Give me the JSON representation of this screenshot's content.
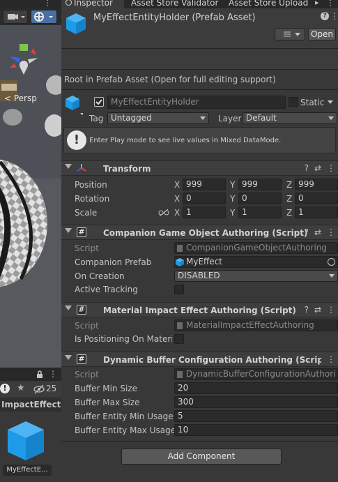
{
  "scene": {
    "persp_label": "< Persp"
  },
  "project": {
    "folder_name": "ImpactEffects",
    "visibility_count": "25",
    "asset_name": "MyEffectE..."
  },
  "tabs": [
    "Inspector",
    "Asset Store Validator",
    "Asset Store Upload"
  ],
  "header": {
    "title": "MyEffectEntityHolder (Prefab Asset)",
    "open_label": "Open"
  },
  "root_note": "Root in Prefab Asset (Open for full editing support)",
  "gameobject": {
    "name": "MyEffectEntityHolder",
    "static_label": "Static",
    "tag_label": "Tag",
    "tag_value": "Untagged",
    "layer_label": "Layer",
    "layer_value": "Default"
  },
  "info": {
    "icon": "!",
    "message": "Enter Play mode to see live values in Mixed DataMode."
  },
  "transform": {
    "title": "Transform",
    "rows": [
      {
        "label": "Position",
        "x": "999",
        "y": "999",
        "z": "999"
      },
      {
        "label": "Rotation",
        "x": "0",
        "y": "0",
        "z": "0"
      },
      {
        "label": "Scale",
        "x": "1",
        "y": "1",
        "z": "1"
      }
    ]
  },
  "companion": {
    "title": "Companion Game Object Authoring (Script)",
    "script_label": "Script",
    "script_value": "CompanionGameObjectAuthoring",
    "prefab_label": "Companion Prefab",
    "prefab_value": "MyEffect",
    "creation_label": "On Creation",
    "creation_value": "DISABLED",
    "tracking_label": "Active Tracking"
  },
  "material": {
    "title": "Material Impact Effect Authoring (Script)",
    "script_label": "Script",
    "script_value": "MaterialImpactEffectAuthoring",
    "positioning_label": "Is Positioning On Materia"
  },
  "buffer": {
    "title": "Dynamic Buffer Configuration Authoring (Script",
    "script_label": "Script",
    "script_value": "DynamicBufferConfigurationAuthori",
    "rows": [
      {
        "label": "Buffer Min Size",
        "value": "20"
      },
      {
        "label": "Buffer Max Size",
        "value": "300"
      },
      {
        "label": "Buffer Entity Min Usage S",
        "value": "5"
      },
      {
        "label": "Buffer Entity Max Usage",
        "value": "10"
      }
    ]
  },
  "add_component_label": "Add Component",
  "colors": {
    "cube_blue": "#1e9be8",
    "panel": "#383838",
    "field": "#2a2a2a"
  }
}
